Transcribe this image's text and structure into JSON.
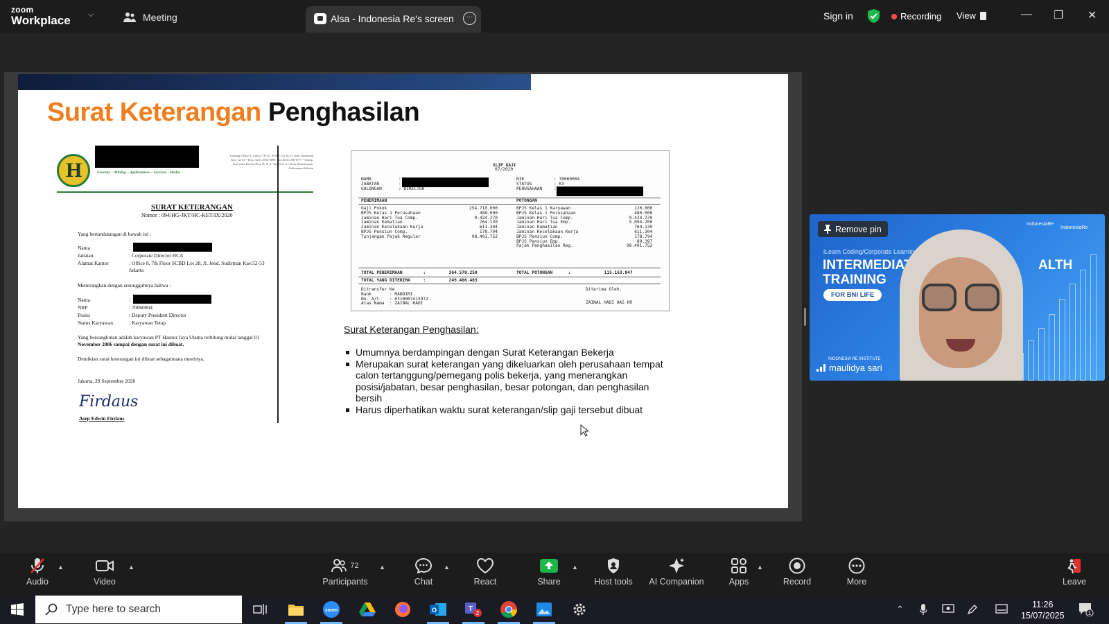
{
  "topbar": {
    "logo_line1": "zoom",
    "logo_line2": "Workplace",
    "meeting_label": "Meeting",
    "share_tab_label": "Alsa - Indonesia Re's screen",
    "signin_label": "Sign in",
    "recording_label": "Recording",
    "view_label": "View"
  },
  "slide": {
    "title_orange": "Surat Keterangan",
    "title_black": "Penghasilan",
    "letter": {
      "tagline": "Forestry – Mining – Agribusiness – Services - Media",
      "address": "Gedung Office 8, Lantai 7 & 10, SCBD Lot 28, Jl. Jend. Sudirman Kav. 52-53 • Telp. (021) 2934-0099, Fax (021) 290-0777 • Komp. Sun Varia Permai Ruq. II, Jl. A. Yani Km. 6 • Kota Banjarmasin, Kalimantan Selatan",
      "heading": "SURAT KETERANGAN",
      "number": "Nomor : 094/HG-JKT/HC-KET/IX/2020",
      "intro": "Yang bertandatangan di bawah ini :",
      "rows1": [
        {
          "label": "Nama",
          "value": ":"
        },
        {
          "label": "Jabatan",
          "value": ": Corporate Director HCA"
        },
        {
          "label": "Alamat Kantor",
          "value": ": Office 8, 7th Floor SCBD Lot 28, Jl. Jend. Sudirman Kav.52-53"
        },
        {
          "label": "",
          "value": "  Jakarta"
        }
      ],
      "middle": "Menerangkan dengan sesungguhnya bahwa :",
      "rows2": [
        {
          "label": "Nama",
          "value": ":"
        },
        {
          "label": "NRP",
          "value": ": 70060004"
        },
        {
          "label": "Posisi",
          "value": ": Deputy President Director"
        },
        {
          "label": "Status Karyawan",
          "value": ": Karyawan Tetap"
        }
      ],
      "para1a": "Yang bersangkutan adalah karyawan PT Hasnur Jaya Utama terhitung mulai tanggal 01",
      "para1b": "November 2006 sampai dengan surat ini dibuat.",
      "para2": "Demikian surat keterangan ini dibuat sebagaimana mestinya.",
      "place_date": "Jakarta, 29 September 2020",
      "signatory": "Asep Edwin Firdaus",
      "signature": "Firdaus"
    },
    "slip": {
      "title": "SLIP GAJI",
      "period": "07/2020",
      "left_header": "NAMA\nJABATAN\nGOLONGAN",
      "left_values": ":\n:\n: DIRECTOR",
      "right_header": "NIK\nSTATUS\nPERUSAHAAN",
      "right_values": ": 70060004\n: K3\n:",
      "penerimaan_label": "PENERIMAAN",
      "potongan_label": "POTONGAN",
      "income_labels": "Gaji Pokok\nBPJS Kelas 1 Perusahaan\nJaminan Hari Tua Comp.\nJaminan Kematian\nJaminan Kecelakaan Kerja\nBPJS Pensiun Comp.\nTunjangan Pajak Regular",
      "income_values": "254.710.000\n480.000\n9.424.270\n764.130\n611.304\n178.794\n98.401.752",
      "deduct_labels": "BPJS Kelas 1 Karyawan\nBPJS Kelas 1 Perusahaan\nJaminan Hari Tua Comp.\nJaminan Hari Tua Emp.\nJaminan Kematian\nJaminan Kecelakaan Kerja\nBPJS Pensiun Comp.\nBPJS Pensiun Emp.\nPajak Penghasilan Reg.",
      "deduct_values": "120.000\n480.000\n9.424.270\n5.094.200\n764.130\n611.304\n178.794\n89.397\n98.401.752",
      "total_penerimaan": "TOTAL PENERIMAAN        :         364.570.250",
      "total_potongan": "TOTAL POTONGAN      :             115.163.847",
      "total_diterima": "TOTAL YANG DITERIMA     :         249.406.403",
      "transfer_block": "Ditransfer Ke\nBank       : MANDIRI\nNo. A/C    : 0310007415972\nAtas Nama  : ZAINAL HADI",
      "diterima_oleh": "Diterima Oleh,",
      "receiver": "ZAINAL HADI HAS HR"
    },
    "bullets_heading": "Surat Keterangan Penghasilan:",
    "bullets": [
      "Umumnya berdampingan dengan Surat Keterangan Bekerja",
      "Merupakan surat keterangan yang dikeluarkan oleh perusahaan tempat calon tertanggung/pemegang polis bekerja, yang menerangkan posisi/jabatan, besar penghasilan, besar potongan, dan penghasilan bersih",
      "Harus diperhatikan waktu surat keterangan/slip gaji tersebut dibuat"
    ]
  },
  "video": {
    "remove_pin_label": "Remove pin",
    "small_text": "iLearn Coding/Corporate Learning",
    "big_line1": "INTERMEDIATE",
    "big_line1_tail": "ALTH",
    "big_line2": "TRAINING",
    "pill": "FOR BNI LIFE",
    "brand1": "IndonesiaRe",
    "brand2": "IndonesiaRe",
    "institute": "INDONESIA RE INSTITUTE",
    "participant_name": "maulidya sari"
  },
  "toolbar": {
    "audio": "Audio",
    "video": "Video",
    "participants": "Participants",
    "participants_count": "72",
    "chat": "Chat",
    "react": "React",
    "share": "Share",
    "host_tools": "Host tools",
    "ai_companion": "AI Companion",
    "apps": "Apps",
    "record": "Record",
    "more": "More",
    "leave": "Leave"
  },
  "taskbar": {
    "search_placeholder": "Type here to search",
    "time": "11:26",
    "date": "15/07/2025",
    "teams_badge": "2",
    "notif_badge": "1"
  },
  "colors": {
    "title_orange": "#f07d1e",
    "recording_red": "#ff4b4b",
    "share_green": "#20b548",
    "shield_green": "#1fb84a",
    "video_blue": "#2f84e6"
  }
}
